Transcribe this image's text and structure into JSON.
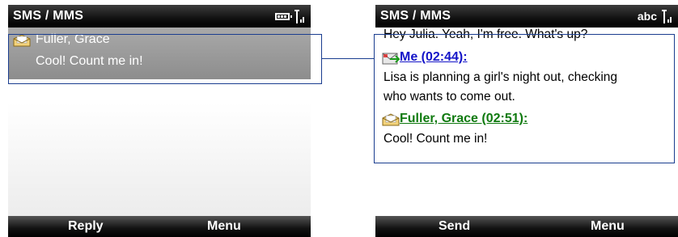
{
  "left_screen": {
    "title": "SMS / MMS",
    "selected_message": {
      "sender": "Fuller, Grace",
      "preview": "Cool! Count me in!"
    },
    "softkeys": {
      "left": "Reply",
      "right": "Menu"
    }
  },
  "right_screen": {
    "title": "SMS / MMS",
    "input_mode": "abc",
    "thread": {
      "top_fragment": "Hey Julia. Yeah, I'm free. What's up?",
      "messages": [
        {
          "sender": "Me (02:44):",
          "lines": [
            "Lisa is planning a girl's night out, checking",
            "who wants to come out."
          ]
        },
        {
          "sender": "Fuller, Grace (02:51):",
          "lines": [
            "Cool! Count me in!"
          ]
        }
      ]
    },
    "softkeys": {
      "left": "Send",
      "right": "Menu"
    }
  },
  "icons": {
    "battery": "battery-icon",
    "signal": "signal-icon",
    "received_message": "open-envelope-icon",
    "sent_message": "sent-message-icon"
  },
  "colors": {
    "title_bar": "#000000",
    "selection": "#9b9b9b",
    "sender_me": "#1414c8",
    "sender_grace": "#0f7a0f",
    "callout": "#1a3d8f"
  }
}
